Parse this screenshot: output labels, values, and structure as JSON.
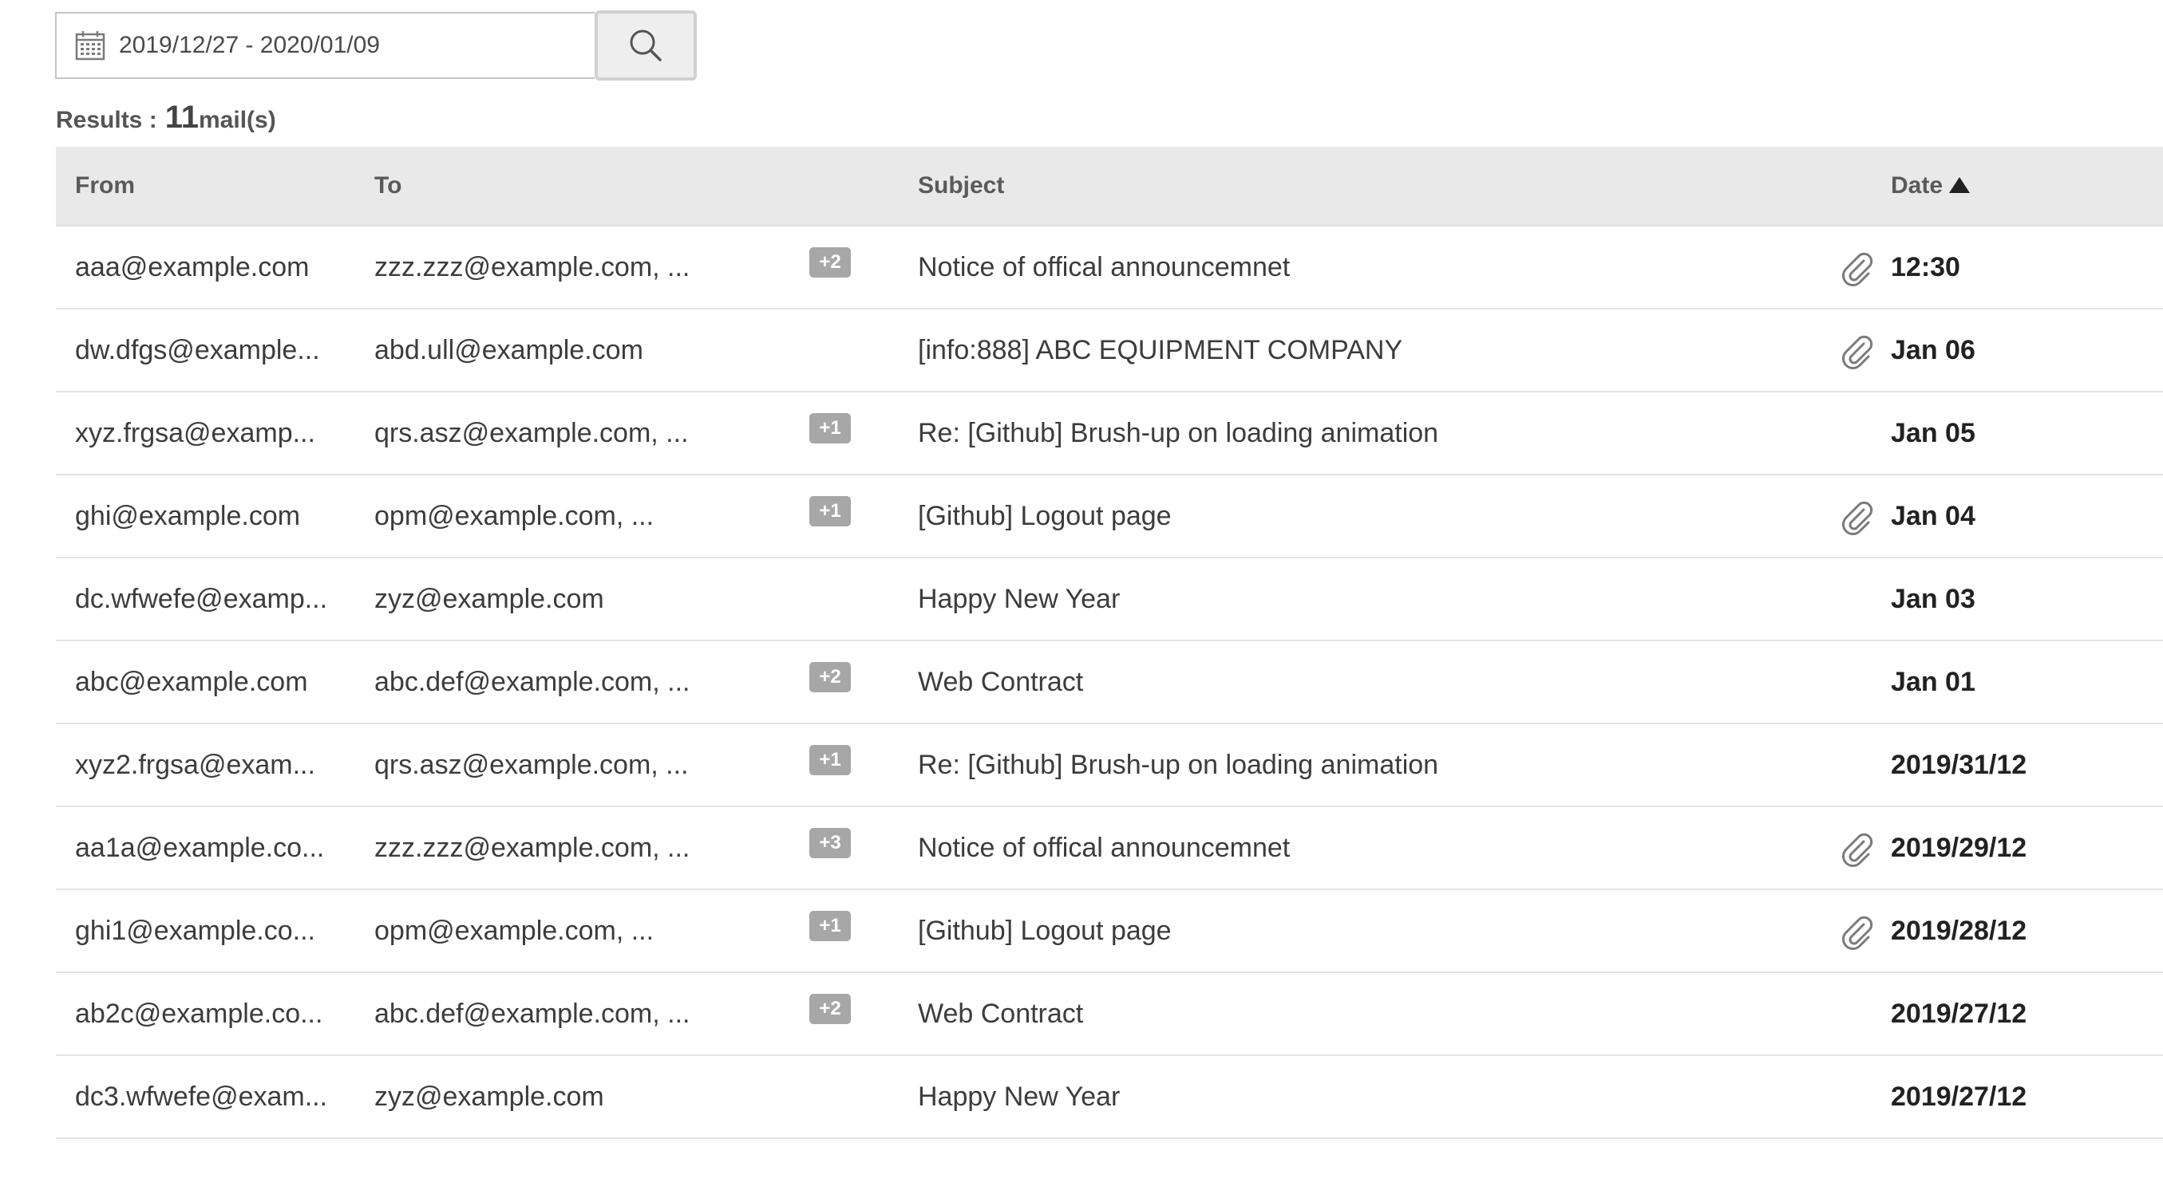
{
  "search": {
    "date_range": "2019/12/27 - 2020/01/09",
    "calendar_icon": "calendar-icon",
    "button_icon": "search-icon"
  },
  "results": {
    "label": "Results :",
    "count": "11",
    "unit": "mail(s)"
  },
  "table": {
    "columns": {
      "from": "From",
      "to": "To",
      "subject": "Subject",
      "date": "Date"
    },
    "sort": {
      "column": "date",
      "direction": "ascending",
      "icon": "sort-up-arrow-icon"
    },
    "rows": [
      {
        "from": "aaa@example.com",
        "to": "zzz.zzz@example.com, ...",
        "badge": "+2",
        "subject": "Notice of offical announcemnet",
        "attachment": true,
        "date": "12:30"
      },
      {
        "from": "dw.dfgs@example...",
        "to": "abd.ull@example.com",
        "badge": "",
        "subject": "[info:888] ABC EQUIPMENT COMPANY",
        "attachment": true,
        "date": "Jan 06"
      },
      {
        "from": "xyz.frgsa@examp...",
        "to": "qrs.asz@example.com, ...",
        "badge": "+1",
        "subject": "Re: [Github] Brush-up on loading animation",
        "attachment": false,
        "date": "Jan 05"
      },
      {
        "from": "ghi@example.com",
        "to": "opm@example.com, ...",
        "badge": "+1",
        "subject": "[Github] Logout page",
        "attachment": true,
        "date": "Jan 04"
      },
      {
        "from": "dc.wfwefe@examp...",
        "to": "zyz@example.com",
        "badge": "",
        "subject": "Happy New Year",
        "attachment": false,
        "date": "Jan 03"
      },
      {
        "from": "abc@example.com",
        "to": "abc.def@example.com, ...",
        "badge": "+2",
        "subject": "Web Contract",
        "attachment": false,
        "date": "Jan 01"
      },
      {
        "from": "xyz2.frgsa@exam...",
        "to": "qrs.asz@example.com, ...",
        "badge": "+1",
        "subject": "Re: [Github] Brush-up on loading animation",
        "attachment": false,
        "date": "2019/31/12"
      },
      {
        "from": "aa1a@example.co...",
        "to": "zzz.zzz@example.com, ...",
        "badge": "+3",
        "subject": "Notice of offical announcemnet",
        "attachment": true,
        "date": "2019/29/12"
      },
      {
        "from": "ghi1@example.co...",
        "to": "opm@example.com, ...",
        "badge": "+1",
        "subject": "[Github] Logout page",
        "attachment": true,
        "date": "2019/28/12"
      },
      {
        "from": "ab2c@example.co...",
        "to": "abc.def@example.com, ...",
        "badge": "+2",
        "subject": "Web Contract",
        "attachment": false,
        "date": "2019/27/12"
      },
      {
        "from": "dc3.wfwefe@exam...",
        "to": "zyz@example.com",
        "badge": "",
        "subject": "Happy New Year",
        "attachment": false,
        "date": "2019/27/12"
      }
    ]
  },
  "colors": {
    "header_bg": "#e9e9e9",
    "badge_bg": "#a7a7a7",
    "row_divider": "#e4e4e4",
    "icon_gray": "#7a7a7a"
  }
}
